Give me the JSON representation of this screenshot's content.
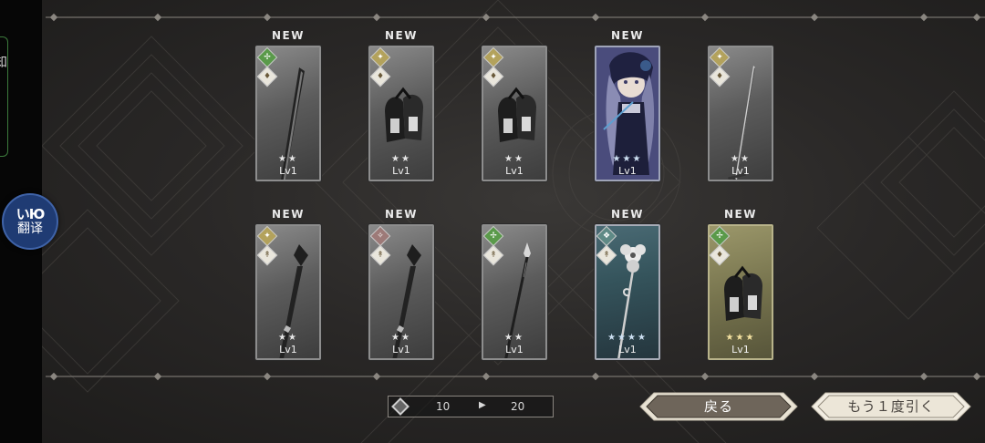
{
  "left_sidebar": {
    "label": "知"
  },
  "translate_button": {
    "logo": "いЮ",
    "label": "翻译"
  },
  "cards": [
    {
      "new": "NEW",
      "level": "Lv1",
      "stars": "★★",
      "attribute": "wind",
      "type": "lantern",
      "art": "greatsword",
      "rarity": "silver"
    },
    {
      "new": "NEW",
      "level": "Lv1",
      "stars": "★★",
      "attribute": "light",
      "type": "lantern",
      "art": "gauntlets",
      "rarity": "silver"
    },
    {
      "new": "",
      "level": "Lv1",
      "stars": "★★",
      "attribute": "light",
      "type": "lantern",
      "art": "gauntlets",
      "rarity": "silver"
    },
    {
      "new": "NEW",
      "level": "Lv1",
      "stars": "★★★",
      "attribute": "none",
      "type": "none",
      "art": "character",
      "rarity": "character"
    },
    {
      "new": "",
      "level": "Lv1",
      "stars": "★★",
      "attribute": "light",
      "type": "lantern",
      "art": "sword",
      "rarity": "silver"
    },
    {
      "new": "NEW",
      "level": "Lv1",
      "stars": "★★",
      "attribute": "light",
      "type": "mace",
      "art": "mace",
      "rarity": "silver"
    },
    {
      "new": "NEW",
      "level": "Lv1",
      "stars": "★★",
      "attribute": "dark",
      "type": "mace",
      "art": "mace",
      "rarity": "silver"
    },
    {
      "new": "",
      "level": "Lv1",
      "stars": "★★",
      "attribute": "wind",
      "type": "mace",
      "art": "spear",
      "rarity": "silver"
    },
    {
      "new": "NEW",
      "level": "Lv1",
      "stars": "★★★★",
      "attribute": "water",
      "type": "mace",
      "art": "flower-staff",
      "rarity": "teal"
    },
    {
      "new": "NEW",
      "level": "Lv1",
      "stars": "★★★",
      "attribute": "wind",
      "type": "lantern",
      "art": "gauntlets",
      "rarity": "gold"
    }
  ],
  "pager": {
    "from": "10",
    "arrow": "▶",
    "to": "20"
  },
  "back_button": {
    "label": "戻る"
  },
  "redraw_button": {
    "label": "もう１度引く"
  },
  "colors": {
    "background": "#2a2827",
    "button_dark": "#6a6055",
    "button_light": "#e8e1d2",
    "frame": "#8a8680"
  }
}
